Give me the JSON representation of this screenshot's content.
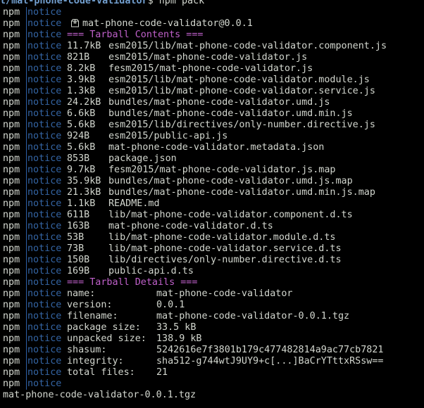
{
  "prompt": {
    "path": "t/mat-phone-code-validator",
    "command": "$ npm pack"
  },
  "prefix": {
    "npm": "npm",
    "notice": "notice"
  },
  "package_line": "mat-phone-code-validator@0.0.1",
  "tarball_contents_header": "=== Tarball Contents ===",
  "files": [
    {
      "size": "11.7kB",
      "path": "esm2015/lib/mat-phone-code-validator.component.js"
    },
    {
      "size": "821B",
      "path": "esm2015/mat-phone-code-validator.js"
    },
    {
      "size": "8.2kB",
      "path": "fesm2015/mat-phone-code-validator.js"
    },
    {
      "size": "3.9kB",
      "path": "esm2015/lib/mat-phone-code-validator.module.js"
    },
    {
      "size": "1.3kB",
      "path": "esm2015/lib/mat-phone-code-validator.service.js"
    },
    {
      "size": "24.2kB",
      "path": "bundles/mat-phone-code-validator.umd.js"
    },
    {
      "size": "6.6kB",
      "path": "bundles/mat-phone-code-validator.umd.min.js"
    },
    {
      "size": "5.6kB",
      "path": "esm2015/lib/directives/only-number.directive.js"
    },
    {
      "size": "924B",
      "path": "esm2015/public-api.js"
    },
    {
      "size": "5.6kB",
      "path": "mat-phone-code-validator.metadata.json"
    },
    {
      "size": "853B",
      "path": "package.json"
    },
    {
      "size": "9.7kB",
      "path": "fesm2015/mat-phone-code-validator.js.map"
    },
    {
      "size": "35.9kB",
      "path": "bundles/mat-phone-code-validator.umd.js.map"
    },
    {
      "size": "21.3kB",
      "path": "bundles/mat-phone-code-validator.umd.min.js.map"
    },
    {
      "size": "1.1kB",
      "path": "README.md"
    },
    {
      "size": "611B",
      "path": "lib/mat-phone-code-validator.component.d.ts"
    },
    {
      "size": "163B",
      "path": "mat-phone-code-validator.d.ts"
    },
    {
      "size": "53B",
      "path": "lib/mat-phone-code-validator.module.d.ts"
    },
    {
      "size": "73B",
      "path": "lib/mat-phone-code-validator.service.d.ts"
    },
    {
      "size": "150B",
      "path": "lib/directives/only-number.directive.d.ts"
    },
    {
      "size": "169B",
      "path": "public-api.d.ts"
    }
  ],
  "tarball_details_header": "=== Tarball Details ===",
  "details": [
    {
      "key": "name:",
      "value": "mat-phone-code-validator"
    },
    {
      "key": "version:",
      "value": "0.0.1"
    },
    {
      "key": "filename:",
      "value": "mat-phone-code-validator-0.0.1.tgz"
    },
    {
      "key": "package size:",
      "value": "33.5 kB"
    },
    {
      "key": "unpacked size:",
      "value": "138.9 kB"
    },
    {
      "key": "shasum:",
      "value": "5242616e7f3801b179c477482814a9ac77cb7821"
    },
    {
      "key": "integrity:",
      "value": "sha512-g744wtJ9UY9+c[...]BaCrYTttxRSsw=="
    },
    {
      "key": "total files:",
      "value": "21"
    }
  ],
  "output_filename": "mat-phone-code-validator-0.0.1.tgz",
  "colors": {
    "background": "#000000",
    "text": "#d3d7cf",
    "notice": "#3465a4",
    "header": "#c061cb",
    "prompt_path": "#729fcf"
  },
  "icons": {
    "package": "package-icon"
  }
}
